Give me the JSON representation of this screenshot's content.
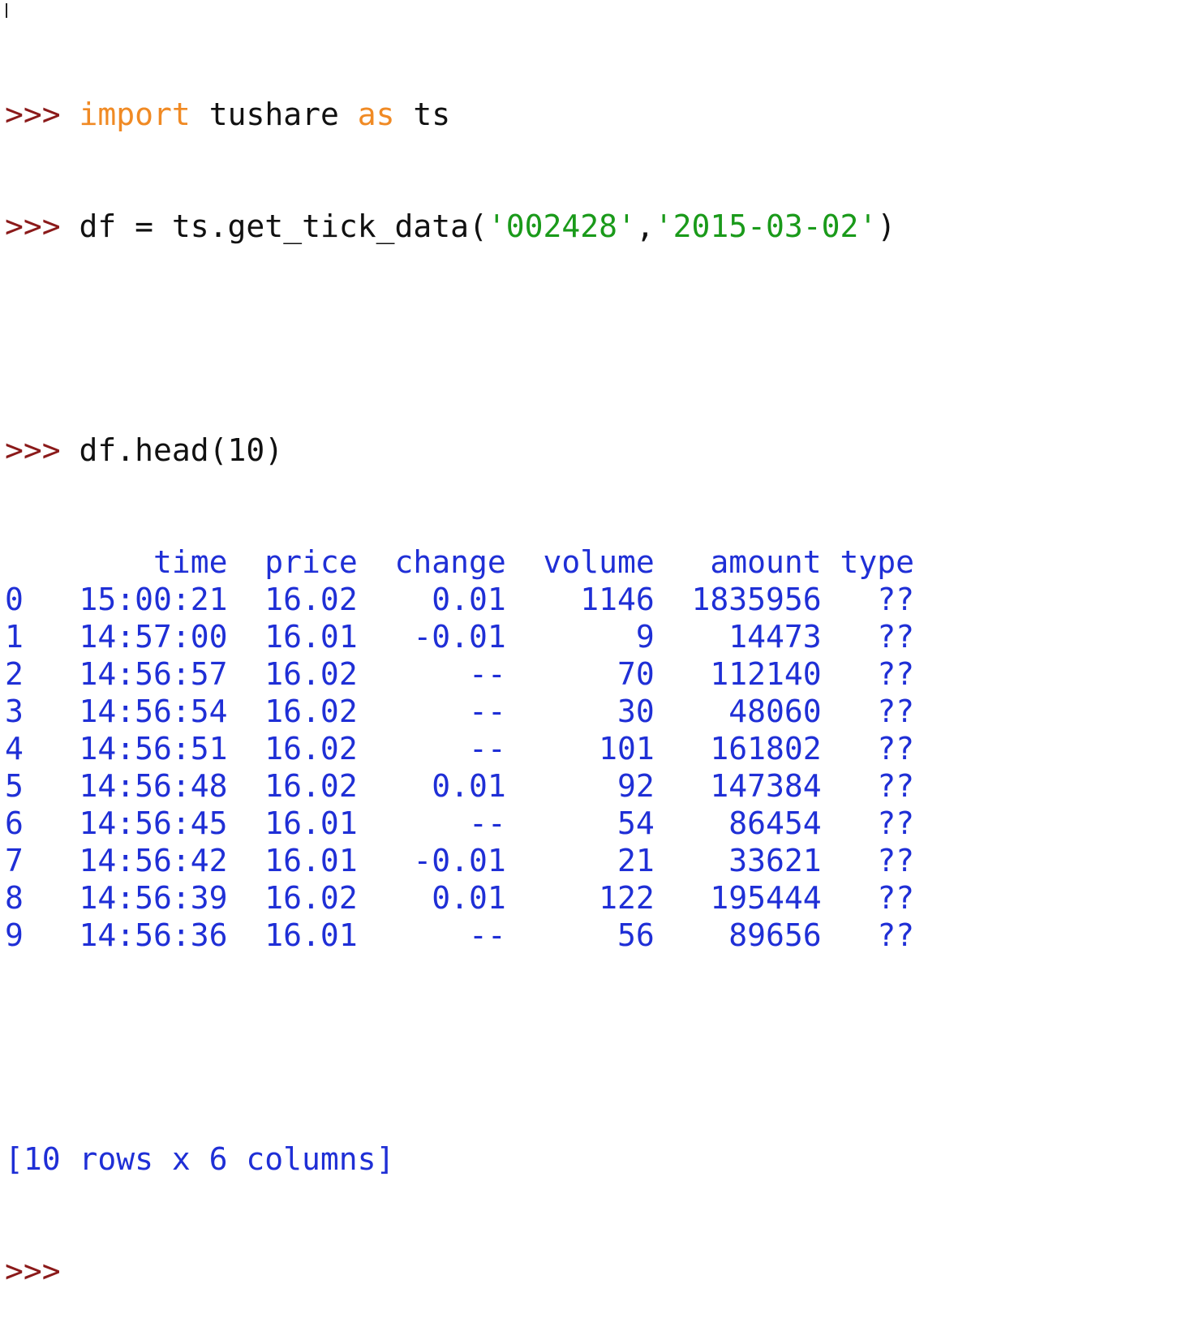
{
  "prompt": ">>>",
  "commands": {
    "line1": {
      "kw_import": "import",
      "module": "tushare",
      "kw_as": "as",
      "alias": "ts"
    },
    "line2": {
      "pre": "df = ts.get_tick_data(",
      "arg1": "'002428'",
      "sep": ",",
      "arg2": "'2015-03-02'",
      "post": ")"
    },
    "line3": {
      "code": "df.head(10)"
    }
  },
  "table": {
    "columns": [
      "time",
      "price",
      "change",
      "volume",
      "amount",
      "type"
    ],
    "rows": [
      {
        "index": "0",
        "time": "15:00:21",
        "price": "16.02",
        "change": "0.01",
        "volume": "1146",
        "amount": "1835956",
        "type": "??"
      },
      {
        "index": "1",
        "time": "14:57:00",
        "price": "16.01",
        "change": "-0.01",
        "volume": "9",
        "amount": "14473",
        "type": "??"
      },
      {
        "index": "2",
        "time": "14:56:57",
        "price": "16.02",
        "change": "--",
        "volume": "70",
        "amount": "112140",
        "type": "??"
      },
      {
        "index": "3",
        "time": "14:56:54",
        "price": "16.02",
        "change": "--",
        "volume": "30",
        "amount": "48060",
        "type": "??"
      },
      {
        "index": "4",
        "time": "14:56:51",
        "price": "16.02",
        "change": "--",
        "volume": "101",
        "amount": "161802",
        "type": "??"
      },
      {
        "index": "5",
        "time": "14:56:48",
        "price": "16.02",
        "change": "0.01",
        "volume": "92",
        "amount": "147384",
        "type": "??"
      },
      {
        "index": "6",
        "time": "14:56:45",
        "price": "16.01",
        "change": "--",
        "volume": "54",
        "amount": "86454",
        "type": "??"
      },
      {
        "index": "7",
        "time": "14:56:42",
        "price": "16.01",
        "change": "-0.01",
        "volume": "21",
        "amount": "33621",
        "type": "??"
      },
      {
        "index": "8",
        "time": "14:56:39",
        "price": "16.02",
        "change": "0.01",
        "volume": "122",
        "amount": "195444",
        "type": "??"
      },
      {
        "index": "9",
        "time": "14:56:36",
        "price": "16.01",
        "change": "--",
        "volume": "56",
        "amount": "89656",
        "type": "??"
      }
    ],
    "summary": "[10 rows x 6 columns]"
  },
  "colors": {
    "prompt": "#8b1a1a",
    "keyword": "#f08a24",
    "string": "#1a9a1a",
    "output": "#1f2fd6",
    "text": "#111111",
    "background": "#ffffff"
  }
}
